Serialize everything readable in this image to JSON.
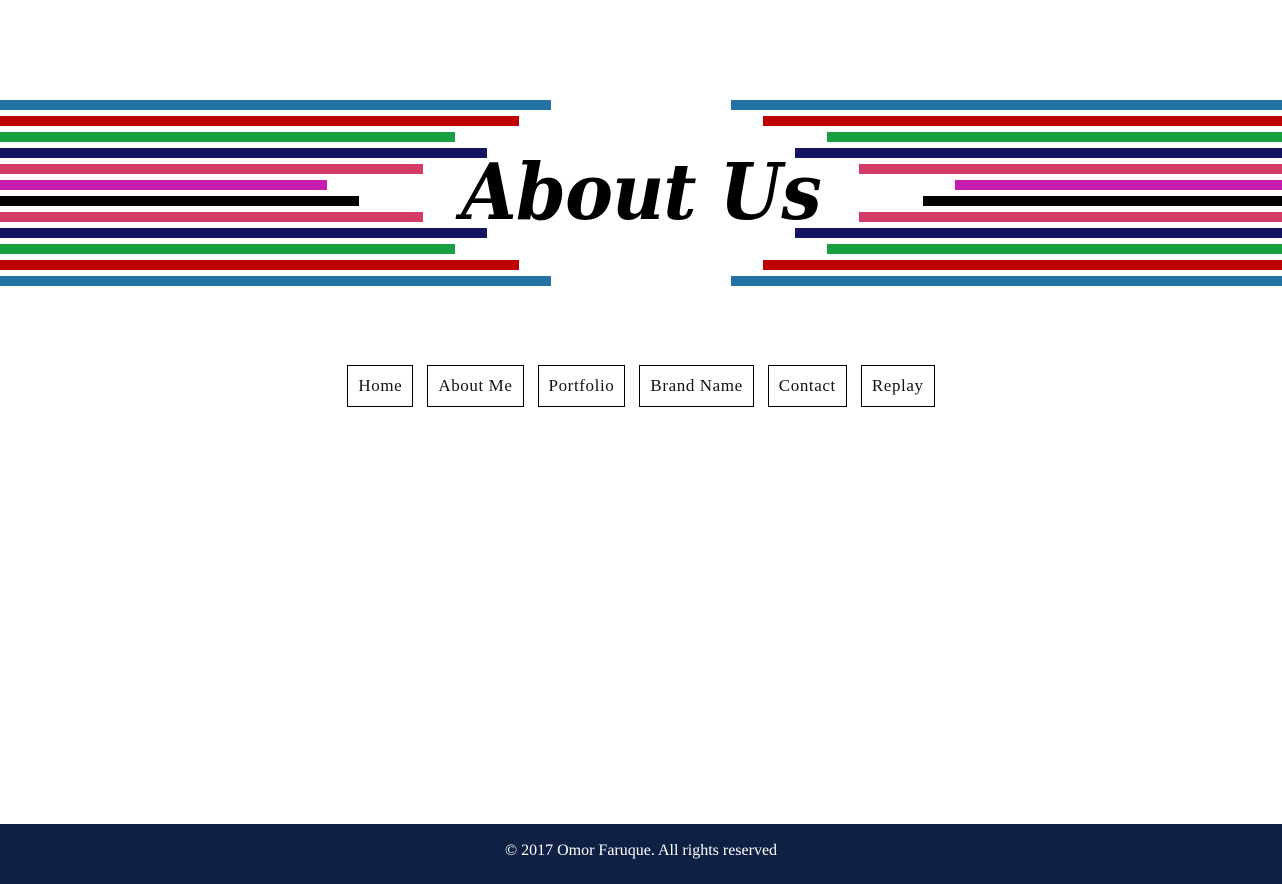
{
  "header": {
    "title": "About Us",
    "stripe_colors": [
      "#2471a6",
      "#c00000",
      "#18a040",
      "#141460",
      "#d63a66",
      "#c81cb0",
      "#000000",
      "#d63a66",
      "#141460",
      "#18a040",
      "#c00000",
      "#2471a6"
    ]
  },
  "nav": {
    "items": [
      {
        "label": "Home"
      },
      {
        "label": "About Me"
      },
      {
        "label": "Portfolio"
      },
      {
        "label": "Brand Name"
      },
      {
        "label": "Contact"
      },
      {
        "label": "Replay"
      }
    ]
  },
  "footer": {
    "copyright": "© 2017 Omor Faruque. All rights reserved",
    "background": "#0e2144"
  }
}
